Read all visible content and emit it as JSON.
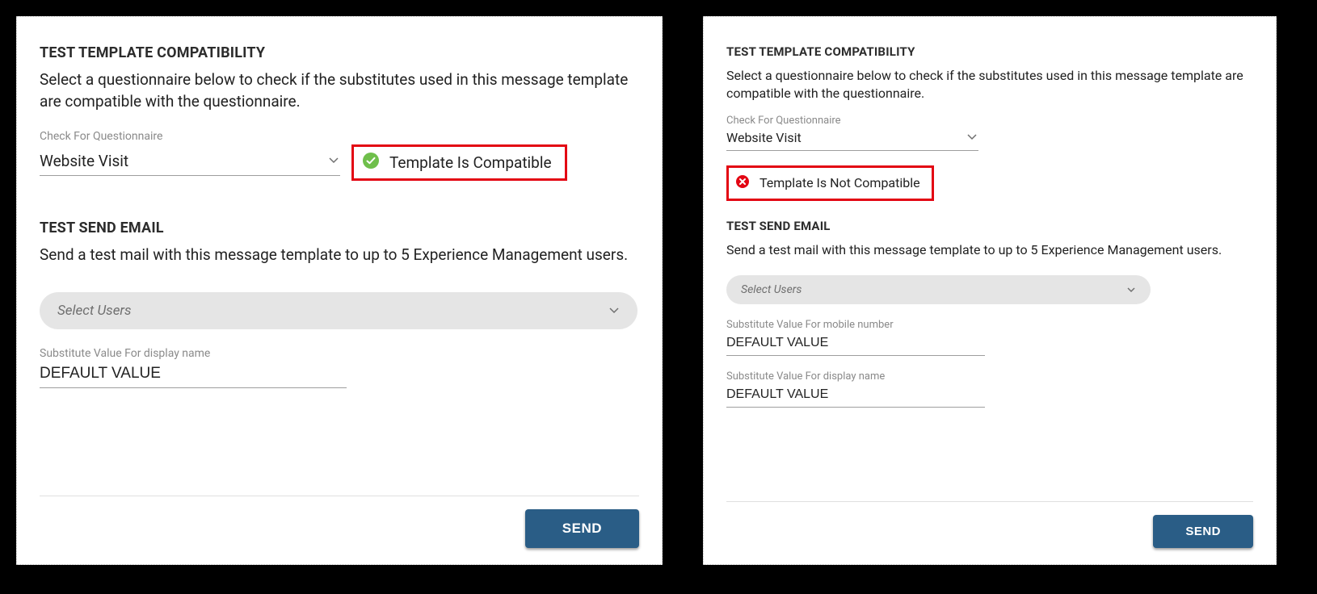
{
  "left": {
    "compat": {
      "title": "TEST TEMPLATE COMPATIBILITY",
      "desc": "Select a questionnaire below to check if the substitutes used in this message template are compatible with the questionnaire.",
      "select_label": "Check For Questionnaire",
      "select_value": "Website Visit",
      "status_icon": "check-circle",
      "status_text": "Template Is Compatible"
    },
    "send": {
      "title": "TEST SEND EMAIL",
      "desc": "Send a test mail with this message template to up to 5 Experience Management users.",
      "users_placeholder": "Select Users",
      "subs": [
        {
          "label": "Substitute Value For display name",
          "value": "DEFAULT VALUE"
        }
      ],
      "button": "SEND"
    }
  },
  "right": {
    "compat": {
      "title": "TEST TEMPLATE COMPATIBILITY",
      "desc": "Select a questionnaire below to check if the substitutes used in this message template are compatible with the questionnaire.",
      "select_label": "Check For Questionnaire",
      "select_value": "Website Visit",
      "status_icon": "x-circle",
      "status_text": "Template Is Not Compatible"
    },
    "send": {
      "title": "TEST SEND EMAIL",
      "desc": "Send a test mail with this message template to up to 5 Experience Management users.",
      "users_placeholder": "Select Users",
      "subs": [
        {
          "label": "Substitute Value For mobile number",
          "value": "DEFAULT VALUE"
        },
        {
          "label": "Substitute Value For display name",
          "value": "DEFAULT VALUE"
        }
      ],
      "button": "SEND"
    }
  }
}
